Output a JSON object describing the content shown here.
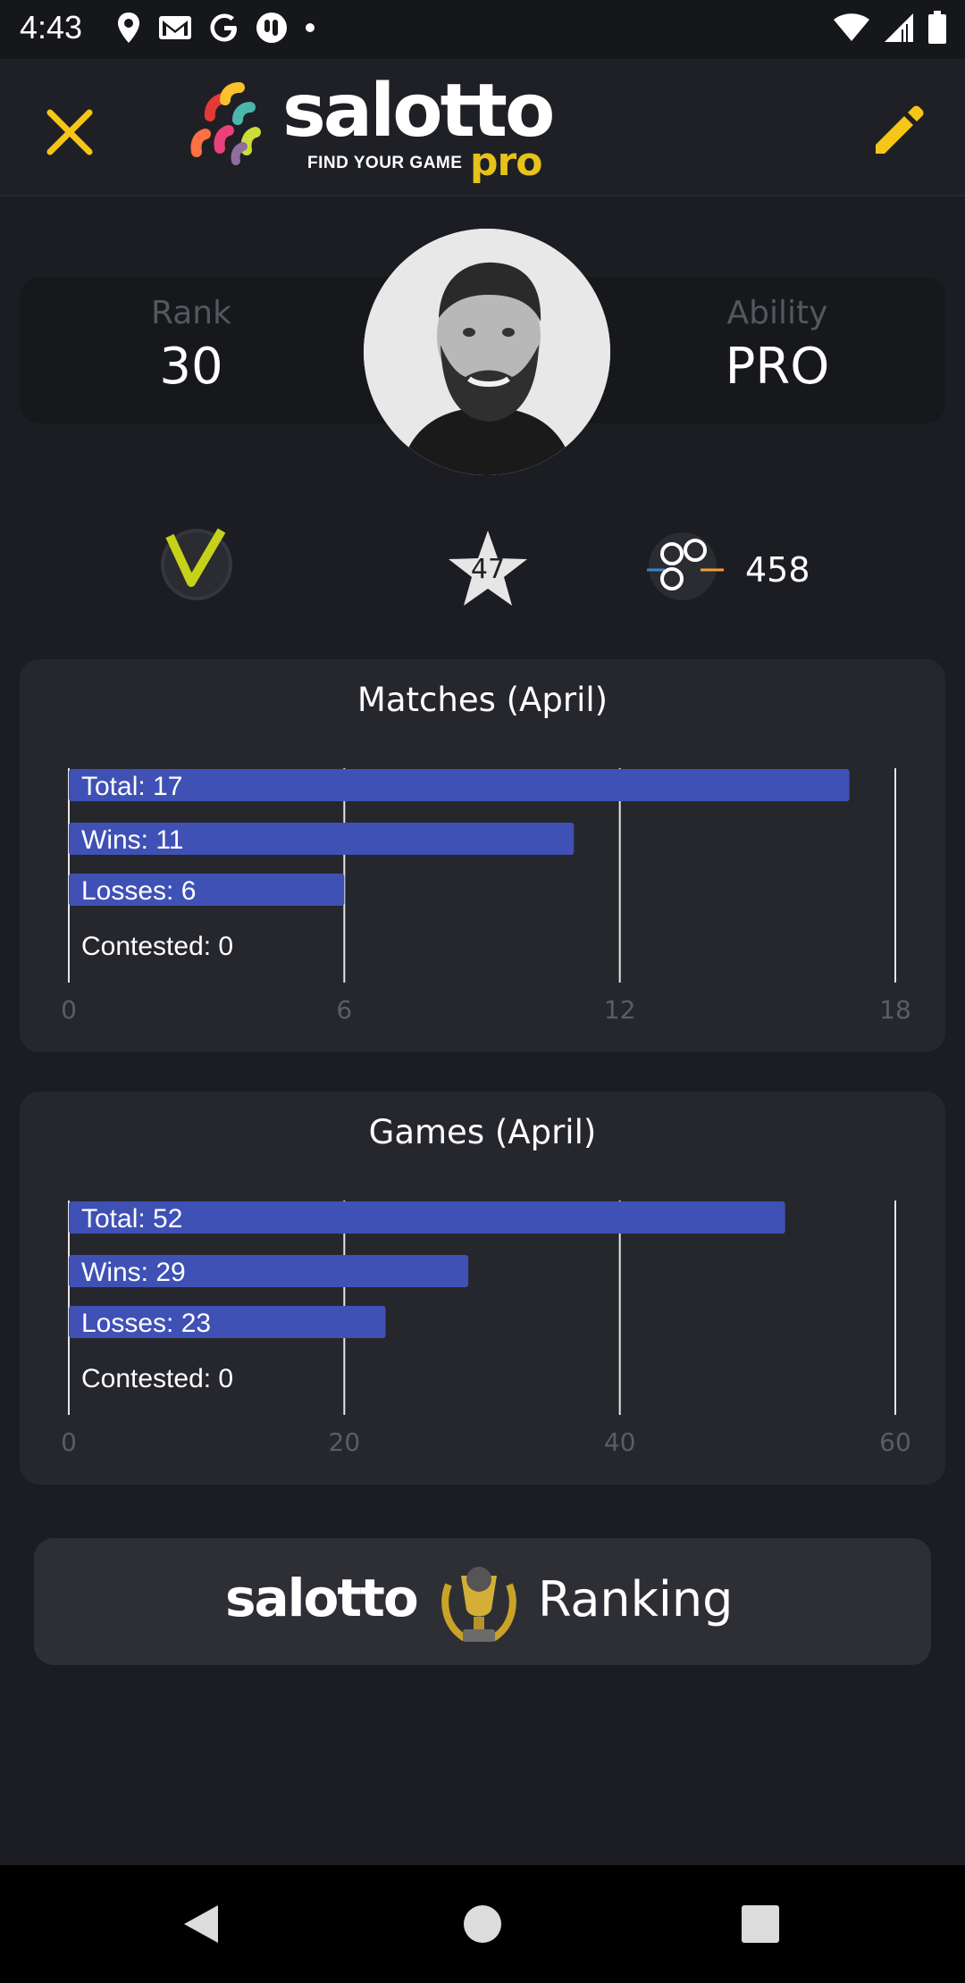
{
  "status_bar": {
    "time": "4:43",
    "icons_left": [
      "location-icon",
      "gmail-icon",
      "google-icon",
      "app-icon",
      "dot-icon"
    ],
    "icons_right": [
      "wifi-icon",
      "signal-icon",
      "battery-icon"
    ]
  },
  "app_bar": {
    "logo_word": "salotto",
    "logo_tagline": "FIND YOUR GAME",
    "logo_pro": "pro",
    "close_icon": "close-icon",
    "edit_icon": "pencil-icon",
    "accent_color": "#f5c518"
  },
  "profile": {
    "rank_label": "Rank",
    "rank_value": "30",
    "ability_label": "Ability",
    "ability_value": "PRO"
  },
  "badges": {
    "verified_icon": "checkmark-badge-icon",
    "star_value": "47",
    "points_value": "458"
  },
  "charts": {
    "bar_color": "#3f51b5",
    "matches": {
      "title": "Matches (April)",
      "labels": [
        "Total: 17",
        "Wins: 11",
        "Losses: 6",
        "Contested: 0"
      ],
      "ticks": [
        "0",
        "6",
        "12",
        "18"
      ]
    },
    "games": {
      "title": "Games (April)",
      "labels": [
        "Total: 52",
        "Wins: 29",
        "Losses: 23",
        "Contested: 0"
      ],
      "ticks": [
        "0",
        "20",
        "40",
        "60"
      ]
    }
  },
  "chart_data": [
    {
      "type": "bar",
      "title": "Matches (April)",
      "categories": [
        "Total",
        "Wins",
        "Losses",
        "Contested"
      ],
      "values": [
        17,
        11,
        6,
        0
      ],
      "xlim": [
        0,
        18
      ],
      "grid": true
    },
    {
      "type": "bar",
      "title": "Games (April)",
      "categories": [
        "Total",
        "Wins",
        "Losses",
        "Contested"
      ],
      "values": [
        52,
        29,
        23,
        0
      ],
      "xlim": [
        0,
        60
      ],
      "grid": true
    }
  ],
  "ranking_button": {
    "word": "salotto",
    "label": "Ranking"
  },
  "nav_bar": {
    "icons": [
      "back-icon",
      "home-icon",
      "recents-icon"
    ]
  }
}
